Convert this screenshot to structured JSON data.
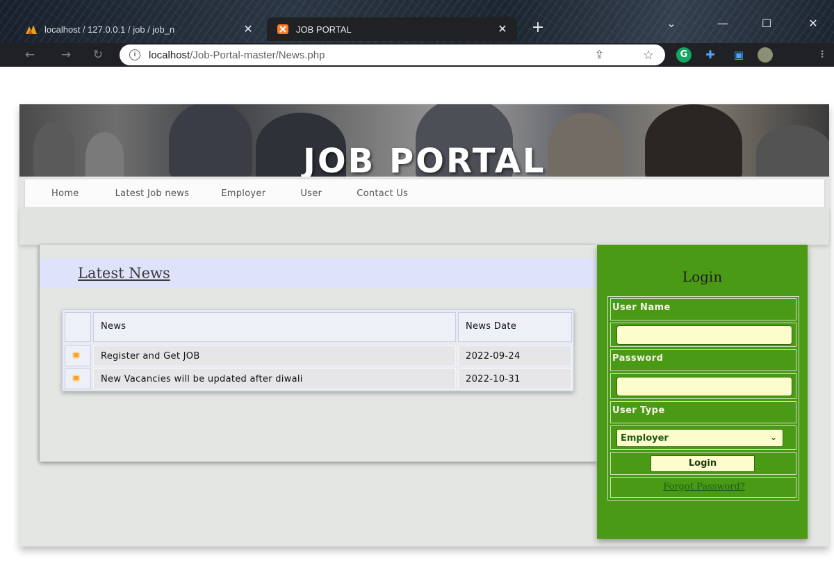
{
  "browser": {
    "tabs": [
      {
        "title": "localhost / 127.0.0.1 / job / job_n",
        "favicon": "phpmyadmin-icon"
      },
      {
        "title": "JOB PORTAL",
        "favicon": "xampp-icon"
      }
    ],
    "url": {
      "host": "localhost",
      "path": "/Job-Portal-master/News.php"
    },
    "colors": {
      "tab_bar": "#1b2530",
      "toolbar": "#202124"
    }
  },
  "site": {
    "banner_title": "JOB PORTAL",
    "menu": [
      "Home",
      "Latest Job news",
      "Employer",
      "User",
      "Contact Us"
    ]
  },
  "news": {
    "heading": "Latest News",
    "columns": [
      "News",
      "News Date"
    ],
    "rows": [
      {
        "title": "Register and Get JOB",
        "date": "2022-09-24"
      },
      {
        "title": "New Vacancies will be updated after diwali",
        "date": "2022-10-31"
      }
    ]
  },
  "login": {
    "title": "Login",
    "username_label": "User Name",
    "username_value": "",
    "password_label": "Password",
    "password_value": "",
    "usertype_label": "User Type",
    "usertype_selected": "Employer",
    "submit_label": "Login",
    "forgot_label": "Forgot Password?",
    "colors": {
      "panel": "#4b9a16",
      "field": "#fdfccc"
    }
  }
}
